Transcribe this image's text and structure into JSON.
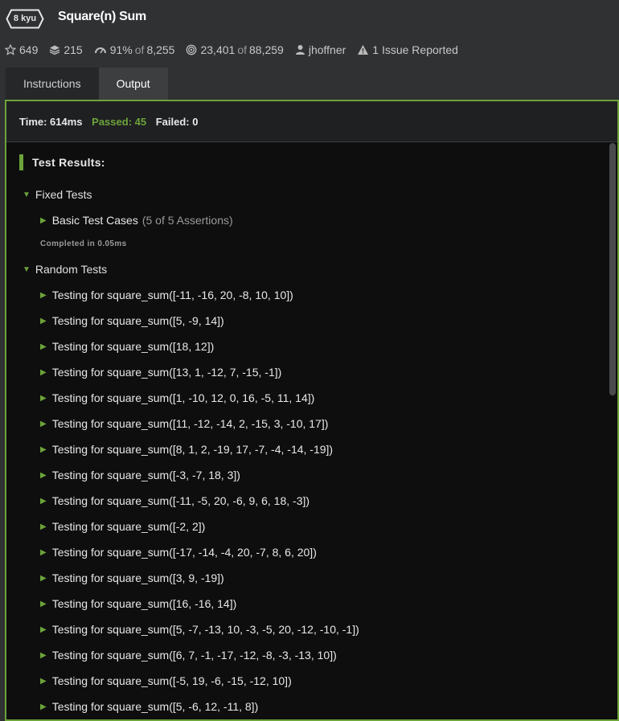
{
  "kata": {
    "rank": "8 kyu",
    "title": "Square(n) Sum"
  },
  "stats": {
    "stars": "649",
    "collections": "215",
    "satisfaction_pct": "91%",
    "satisfaction_of": "of",
    "satisfaction_votes": "8,255",
    "completed": "23,401",
    "completed_of": "of",
    "attempted": "88,259",
    "author": "jhoffner",
    "issues": "1 Issue Reported"
  },
  "tabs": [
    {
      "label": "Instructions",
      "active": false
    },
    {
      "label": "Output",
      "active": true
    }
  ],
  "summary": {
    "time": "Time: 614ms",
    "passed": "Passed: 45",
    "failed": "Failed: 0"
  },
  "results": {
    "heading": "Test Results:",
    "fixed": {
      "label": "Fixed Tests",
      "case_label": "Basic Test Cases",
      "case_assertions": "(5 of 5 Assertions)",
      "completed": "Completed in 0.05ms"
    },
    "random": {
      "label": "Random Tests",
      "cases": [
        "Testing for square_sum([-11, -16, 20, -8, 10, 10])",
        "Testing for square_sum([5, -9, 14])",
        "Testing for square_sum([18, 12])",
        "Testing for square_sum([13, 1, -12, 7, -15, -1])",
        "Testing for square_sum([1, -10, 12, 0, 16, -5, 11, 14])",
        "Testing for square_sum([11, -12, -14, 2, -15, 3, -10, 17])",
        "Testing for square_sum([8, 1, 2, -19, 17, -7, -4, -14, -19])",
        "Testing for square_sum([-3, -7, 18, 3])",
        "Testing for square_sum([-11, -5, 20, -6, 9, 6, 18, -3])",
        "Testing for square_sum([-2, 2])",
        "Testing for square_sum([-17, -14, -4, 20, -7, 8, 6, 20])",
        "Testing for square_sum([3, 9, -19])",
        "Testing for square_sum([16, -16, 14])",
        "Testing for square_sum([5, -7, -13, 10, -3, -5, 20, -12, -10, -1])",
        "Testing for square_sum([6, 7, -1, -17, -12, -8, -3, -13, 10])",
        "Testing for square_sum([-5, 19, -6, -15, -12, 10])",
        "Testing for square_sum([5, -6, 12, -11, 8])"
      ]
    }
  },
  "colors": {
    "accent": "#6ca33a",
    "background": "#303133",
    "panel": "#0e0e0f"
  },
  "icons": [
    "star-icon",
    "collection-icon",
    "satisfaction-icon",
    "completion-icon",
    "user-icon",
    "warning-icon",
    "caret-down-icon",
    "caret-right-icon"
  ]
}
